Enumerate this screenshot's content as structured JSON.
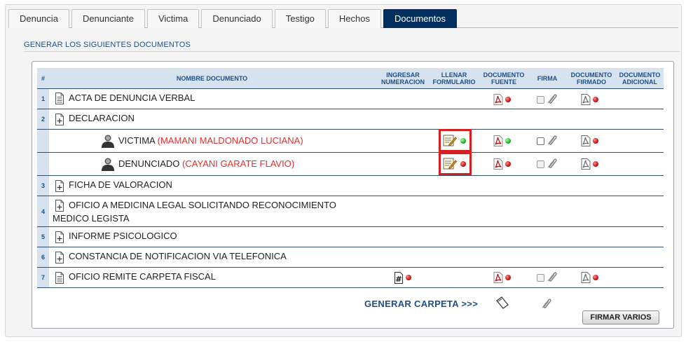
{
  "tabs": [
    {
      "label": "Denuncia",
      "active": false
    },
    {
      "label": "Denunciante",
      "active": false
    },
    {
      "label": "Victima",
      "active": false
    },
    {
      "label": "Denunciado",
      "active": false
    },
    {
      "label": "Testigo",
      "active": false
    },
    {
      "label": "Hechos",
      "active": false
    },
    {
      "label": "Documentos",
      "active": true
    }
  ],
  "section_title": "GENERAR LOS SIGUIENTES DOCUMENTOS",
  "table": {
    "headers": {
      "num": "#",
      "nombre": "NOMBRE DOCUMENTO",
      "ingresar": "INGRESAR NUMERACION",
      "llenar": "LLENAR FORMULARIO",
      "fuente": "DOCUMENTO FUENTE",
      "firma": "FIRMA",
      "firmado": "DOCUMENTO FIRMADO",
      "adicional": "DOCUMENTO ADICIONAL"
    },
    "rows": [
      {
        "num": "1",
        "label": "ACTA DE DENUNCIA VERBAL"
      },
      {
        "num": "2",
        "label": "DECLARACION"
      },
      {
        "num": "",
        "label": "VICTIMA",
        "person": "(MAMANI MALDONADO LUCIANA)"
      },
      {
        "num": "",
        "label": "DENUNCIADO",
        "person": "(CAYANI GARATE FLAVIO)"
      },
      {
        "num": "3",
        "label": "FICHA DE VALORACION"
      },
      {
        "num": "4",
        "label": "OFICIO A MEDICINA LEGAL SOLICITANDO RECONOCIMIENTO MEDICO LEGISTA"
      },
      {
        "num": "5",
        "label": "INFORME PSICOLOGICO"
      },
      {
        "num": "6",
        "label": "CONSTANCIA DE NOTIFICACION VIA TELEFONICA"
      },
      {
        "num": "7",
        "label": "OFICIO REMITE CARPETA FISCAL"
      }
    ]
  },
  "generar_label": "GENERAR CARPETA >>>",
  "firmar_button": "FIRMAR VARIOS",
  "colors": {
    "active_tab": "#00305f",
    "header_bg": "#d7e2ef",
    "link_blue": "#1c4e8a",
    "highlight_red": "#d81e1e",
    "status_red": "#c00000",
    "status_green": "#11a011"
  },
  "icons": {
    "document": "document-icon",
    "expand": "expand-icon",
    "person": "person-icon",
    "pdf": "pdf-icon",
    "form": "edit-form-icon",
    "numbering": "numbering-icon",
    "clip": "paperclip-icon",
    "signed": "signed-document-icon",
    "folder": "tag-icon"
  }
}
